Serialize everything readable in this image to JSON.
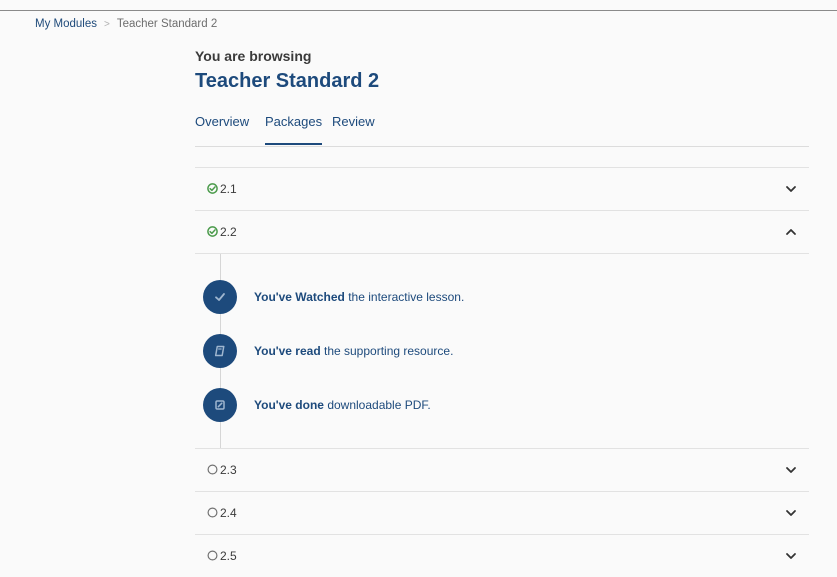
{
  "breadcrumb": {
    "root": "My Modules",
    "separator": ">",
    "current": "Teacher Standard 2"
  },
  "header": {
    "subtitle": "You are browsing",
    "title": "Teacher Standard 2"
  },
  "tabs": [
    {
      "label": "Overview",
      "active": false
    },
    {
      "label": "Packages",
      "active": true
    },
    {
      "label": "Review",
      "active": false
    }
  ],
  "packages": [
    {
      "number": "2.1",
      "status": "complete",
      "expanded": false
    },
    {
      "number": "2.2",
      "status": "complete",
      "expanded": true
    },
    {
      "number": "2.3",
      "status": "incomplete",
      "expanded": false
    },
    {
      "number": "2.4",
      "status": "incomplete",
      "expanded": false
    },
    {
      "number": "2.5",
      "status": "incomplete",
      "expanded": false
    }
  ],
  "steps": [
    {
      "icon": "check-icon",
      "bold": "You've Watched",
      "rest": " the interactive lesson."
    },
    {
      "icon": "book-icon",
      "bold": "You've read",
      "rest": " the supporting resource."
    },
    {
      "icon": "edit-icon",
      "bold": "You've done",
      "rest": " downloadable PDF."
    }
  ],
  "colors": {
    "accent": "#1d4a7c",
    "complete": "#4a9a4a",
    "incomplete": "#707070"
  }
}
